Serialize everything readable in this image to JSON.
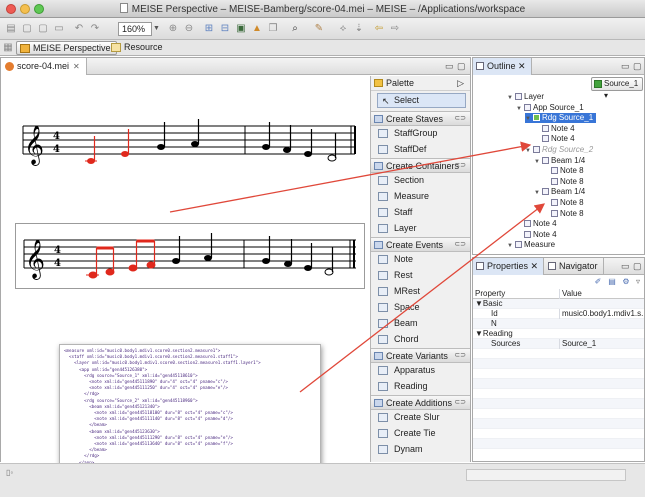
{
  "window": {
    "title": "MEISE Perspective – MEISE-Bamberg/score-04.mei – MEISE – /Applications/workspace"
  },
  "toolbar": {
    "zoom_value": "160%"
  },
  "perspectives": {
    "active": "MEISE Perspective",
    "other": "Resource"
  },
  "editor": {
    "tab_label": "score-04.mei",
    "xml_lines": [
      "<measure xml:id=\"music0.body1.mdiv1.score0.section2.measure1\">",
      "  <staff xml:id=\"music0.body1.mdiv1.score0.section2.measure1.staff1\">",
      "    <layer xml:id=\"music0.body1.mdiv1.score0.section2.measure1.staff1.layer1\">",
      "      <app xml:id=\"gen445126380\">",
      "        <rdg source=\"Source_1\" xml:id=\"gen445118610\">",
      "          <note xml:id=\"gen445111890\" dur=\"4\" oct=\"4\" pname=\"c\"/>",
      "          <note xml:id=\"gen445111250\" dur=\"4\" oct=\"4\" pname=\"e\"/>",
      "        </rdg>",
      "        <rdg source=\"Source_2\" xml:id=\"gen445118960\">",
      "          <beam xml:id=\"gen445121340\">",
      "            <note xml:id=\"gen445118100\" dur=\"8\" oct=\"4\" pname=\"c\"/>",
      "            <note xml:id=\"gen445111140\" dur=\"8\" oct=\"4\" pname=\"d\"/>",
      "          </beam>",
      "          <beam xml:id=\"gen445123630\">",
      "            <note xml:id=\"gen445111290\" dur=\"8\" oct=\"4\" pname=\"e\"/>",
      "            <note xml:id=\"gen445113640\" dur=\"8\" oct=\"4\" pname=\"f\"/>",
      "          </beam>",
      "        </rdg>",
      "      </app>",
      "      <note xml:id=\"gen445124960\" dur=\"4\" oct=\"4\" pname=\"g\"/>",
      "      <note xml:id=\"gen445125070\" dur=\"4\" oct=\"4\" pname=\"a\"/>",
      "    </layer>",
      "  </staff>",
      "</measure>"
    ]
  },
  "palette": {
    "header": "Palette",
    "select": "Select",
    "drawers": [
      {
        "title": "Create Staves",
        "tools": [
          "StaffGroup",
          "StaffDef"
        ]
      },
      {
        "title": "Create Containers",
        "tools": [
          "Section",
          "Measure",
          "Staff",
          "Layer"
        ]
      },
      {
        "title": "Create Events",
        "tools": [
          "Note",
          "Rest",
          "MRest",
          "Space",
          "Beam",
          "Chord"
        ]
      },
      {
        "title": "Create Variants",
        "tools": [
          "Apparatus",
          "Reading"
        ]
      },
      {
        "title": "Create Additions",
        "tools": [
          "Create Slur",
          "Create Tie",
          "Dynam"
        ]
      }
    ]
  },
  "outline": {
    "tab_label": "Outline",
    "source_combo": "Source_1",
    "tree": [
      {
        "label": "Layer",
        "depth": 0,
        "state": "open"
      },
      {
        "label": "App Source_1",
        "depth": 1,
        "state": "open"
      },
      {
        "label": "Rdg Source_1",
        "depth": 2,
        "state": "open",
        "selected": true
      },
      {
        "label": "Note 4",
        "depth": 3
      },
      {
        "label": "Note 4",
        "depth": 3
      },
      {
        "label": "Rdg Source_2",
        "depth": 2,
        "state": "open",
        "disabled": true
      },
      {
        "label": "Beam 1/4",
        "depth": 3,
        "state": "open"
      },
      {
        "label": "Note 8",
        "depth": 4
      },
      {
        "label": "Note 8",
        "depth": 4
      },
      {
        "label": "Beam 1/4",
        "depth": 3,
        "state": "open"
      },
      {
        "label": "Note 8",
        "depth": 4
      },
      {
        "label": "Note 8",
        "depth": 4
      },
      {
        "label": "Note 4",
        "depth": 1
      },
      {
        "label": "Note 4",
        "depth": 1
      },
      {
        "label": "Measure",
        "depth": 0,
        "state": "open"
      }
    ]
  },
  "properties": {
    "tab_label": "Properties",
    "nav_tab_label": "Navigator",
    "col_property": "Property",
    "col_value": "Value",
    "rows": [
      {
        "key": "▼Basic",
        "value": ""
      },
      {
        "key": "Id",
        "value": "music0.body1.mdiv1.s..."
      },
      {
        "key": "N",
        "value": ""
      },
      {
        "key": "▼Reading",
        "value": ""
      },
      {
        "key": "Sources",
        "value": "Source_1"
      }
    ]
  },
  "colors": {
    "highlight_note": "#e0281c",
    "selection": "#3875d7",
    "arrow": "#e0483a"
  }
}
